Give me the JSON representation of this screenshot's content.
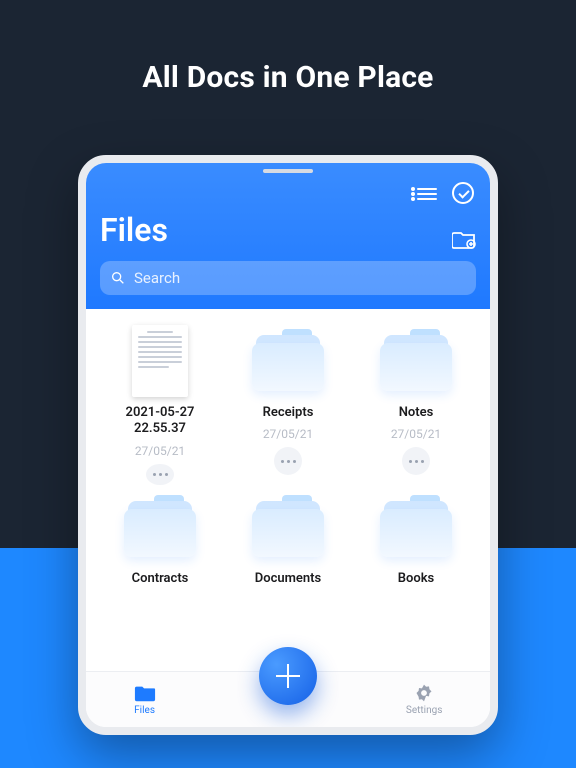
{
  "heading": "All Docs in One Place",
  "app": {
    "title": "Files",
    "search_placeholder": "Search"
  },
  "items": [
    {
      "name": "2021-05-27 22.55.37",
      "date": "27/05/21",
      "type": "doc"
    },
    {
      "name": "Receipts",
      "date": "27/05/21",
      "type": "folder"
    },
    {
      "name": "Notes",
      "date": "27/05/21",
      "type": "folder"
    },
    {
      "name": "Contracts",
      "date": "",
      "type": "folder"
    },
    {
      "name": "Documents",
      "date": "",
      "type": "folder"
    },
    {
      "name": "Books",
      "date": "",
      "type": "folder"
    }
  ],
  "tabs": {
    "files": "Files",
    "settings": "Settings"
  }
}
